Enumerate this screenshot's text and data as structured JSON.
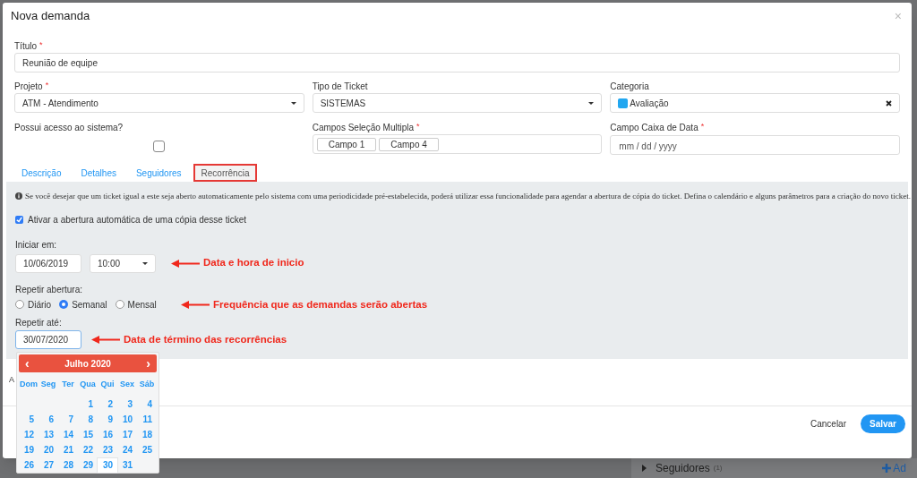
{
  "modal": {
    "title": "Nova demanda",
    "close": "×"
  },
  "fields": {
    "titulo": {
      "label": "Título",
      "required_mark": "*",
      "value": "Reunião de equipe"
    },
    "projeto": {
      "label": "Projeto",
      "required_mark": "*",
      "value": "ATM - Atendimento"
    },
    "tipo": {
      "label": "Tipo de Ticket",
      "value": "SISTEMAS"
    },
    "categoria": {
      "label": "Categoria",
      "value": "Avaliação",
      "color": "#22a7f0"
    },
    "acesso": {
      "label": "Possui acesso ao sistema?",
      "checked": false
    },
    "multipla": {
      "label": "Campos Seleção Multipla",
      "required_mark": "*",
      "tags": [
        "Campo 1",
        "Campo 4"
      ]
    },
    "data": {
      "label": "Campo Caixa de Data",
      "required_mark": "*",
      "placeholder": "mm / dd / yyyy"
    }
  },
  "tabs": [
    {
      "label": "Descrição",
      "selected": false
    },
    {
      "label": "Detalhes",
      "selected": false
    },
    {
      "label": "Seguidores",
      "selected": false
    },
    {
      "label": "Recorrência",
      "selected": true
    }
  ],
  "recurrence": {
    "info": "Se você desejar que um ticket igual a este seja aberto automaticamente pelo sistema com uma periodicidade pré-estabelecida, poderá utilizar essa funcionalidade para agendar a abertura de cópia do ticket. Defina o calendário e alguns parâmetros para a criação do novo ticket.",
    "enable": {
      "label": "Ativar a abertura automática de uma cópia desse ticket",
      "checked": true
    },
    "start_label": "Iniciar em:",
    "start_date": "10/06/2019",
    "start_time": "10:00",
    "repeat_label": "Repetir abertura:",
    "frequencies": [
      {
        "label": "Diário",
        "selected": false
      },
      {
        "label": "Semanal",
        "selected": true
      },
      {
        "label": "Mensal",
        "selected": false
      }
    ],
    "until_label": "Repetir até:",
    "until_date": "30/07/2020"
  },
  "annotations": [
    "Data e hora de inicio",
    "Frequência que as demandas serão abertas",
    "Data de término das recorrências"
  ],
  "partial_label": "A",
  "calendar": {
    "month": "Julho 2020",
    "prev": "‹",
    "next": "›",
    "weekdays": [
      "Dom",
      "Seg",
      "Ter",
      "Qua",
      "Qui",
      "Sex",
      "Sáb"
    ],
    "weeks": [
      [
        {
          "day": "1",
          "selected": false
        },
        {
          "day": "2",
          "selected": false
        },
        {
          "day": "3",
          "selected": false
        },
        {
          "day": "4",
          "selected": false
        }
      ],
      [
        {
          "day": "5",
          "selected": false
        },
        {
          "day": "6",
          "selected": false
        },
        {
          "day": "7",
          "selected": false
        },
        {
          "day": "8",
          "selected": false
        },
        {
          "day": "9",
          "selected": false
        },
        {
          "day": "10",
          "selected": false
        },
        {
          "day": "11",
          "selected": false
        }
      ],
      [
        {
          "day": "12",
          "selected": false
        },
        {
          "day": "13",
          "selected": false
        },
        {
          "day": "14",
          "selected": false
        },
        {
          "day": "15",
          "selected": false
        },
        {
          "day": "16",
          "selected": false
        },
        {
          "day": "17",
          "selected": false
        },
        {
          "day": "18",
          "selected": false
        }
      ],
      [
        {
          "day": "19",
          "selected": false
        },
        {
          "day": "20",
          "selected": false
        },
        {
          "day": "21",
          "selected": false
        },
        {
          "day": "22",
          "selected": false
        },
        {
          "day": "23",
          "selected": false
        },
        {
          "day": "24",
          "selected": false
        },
        {
          "day": "25",
          "selected": false
        }
      ],
      [
        {
          "day": "26",
          "selected": false
        },
        {
          "day": "27",
          "selected": false
        },
        {
          "day": "28",
          "selected": false
        },
        {
          "day": "29",
          "selected": false
        },
        {
          "day": "30",
          "selected": true
        },
        {
          "day": "31",
          "selected": false
        }
      ]
    ]
  },
  "footer": {
    "cancel": "Cancelar",
    "save": "Salvar"
  },
  "background": {
    "section": "Seguidores",
    "count": "(1)",
    "action": "Ad"
  }
}
